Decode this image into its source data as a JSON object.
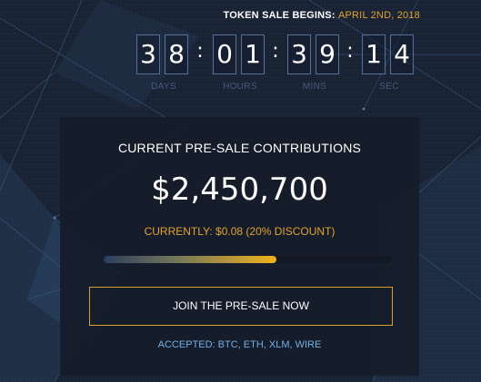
{
  "header": {
    "label": "TOKEN SALE BEGINS:",
    "date": "APRIL 2ND, 2018"
  },
  "countdown": {
    "days": [
      "3",
      "8"
    ],
    "hours": [
      "0",
      "1"
    ],
    "mins": [
      "3",
      "9"
    ],
    "sec": [
      "1",
      "4"
    ],
    "separator": ":",
    "labels": {
      "days": "DAYS",
      "hours": "HOURS",
      "mins": "MINS",
      "sec": "SEC"
    }
  },
  "presale": {
    "title": "CURRENT PRE-SALE CONTRIBUTIONS",
    "amount": "$2,450,700",
    "price_text": "CURRENTLY: $0.08 (20% DISCOUNT)",
    "progress_fraction": 0.6,
    "cta_label": "JOIN THE PRE-SALE NOW",
    "accepted": "ACCEPTED: BTC, ETH, XLM, WIRE"
  },
  "colors": {
    "accent": "#e0a42a",
    "link": "#6fb0e6",
    "background": "#1b2536"
  }
}
